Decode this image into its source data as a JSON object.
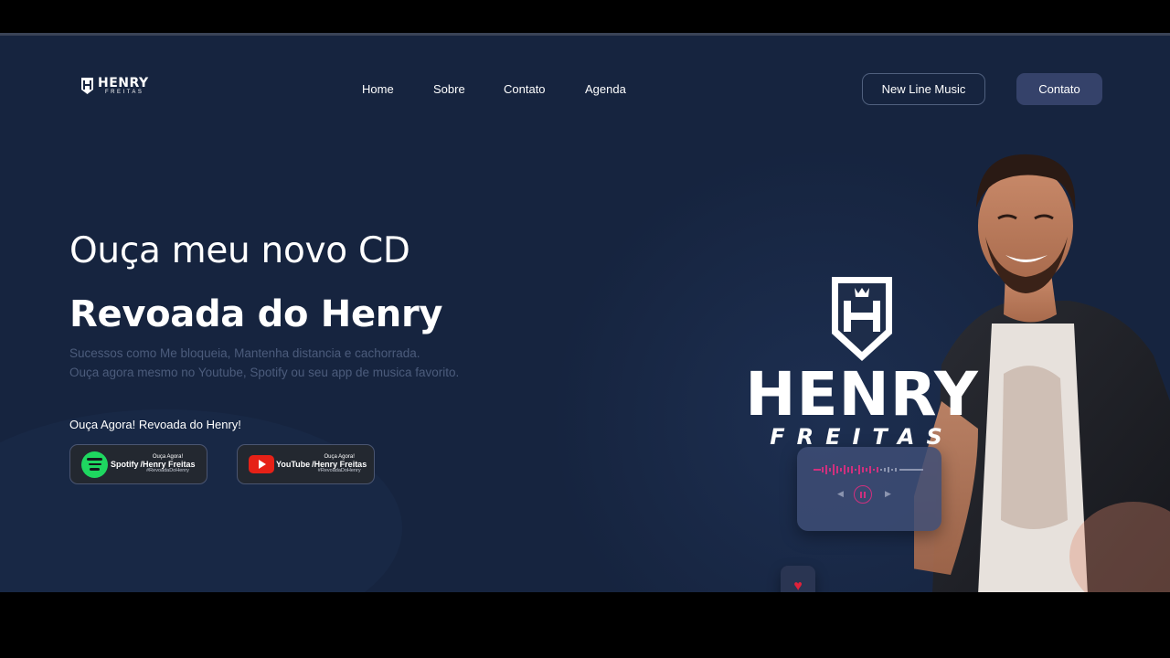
{
  "brand": {
    "name": "HENRY",
    "tagline": "FREITAS"
  },
  "nav": {
    "items": [
      {
        "label": "Home"
      },
      {
        "label": "Sobre"
      },
      {
        "label": "Contato"
      },
      {
        "label": "Agenda"
      }
    ]
  },
  "header_buttons": {
    "outline_label": "New Line Music",
    "solid_label": "Contato"
  },
  "hero": {
    "title": "Ouça meu novo CD",
    "album": "Revoada do Henry",
    "desc_line1": "Sucessos como Me bloqueia, Mantenha distancia e cachorrada.",
    "desc_line2": "Ouça agora mesmo no Youtube, Spotify ou seu app de musica favorito.",
    "listen_label": "Ouça Agora! Revoada do Henry!"
  },
  "streaming": {
    "spotify": {
      "brand": "Spotify",
      "top": "Ouça Agora!",
      "main": "/Henry Freitas",
      "tag": "#RevoadaDoHenry",
      "icon": "spotify-icon",
      "color": "#1ed760"
    },
    "youtube": {
      "brand": "YouTube",
      "top": "Ouça Agora!",
      "main": "/Henry Freitas",
      "tag": "#RevoadaDoHenry",
      "icon": "youtube-icon",
      "color": "#e62117"
    }
  },
  "artwork": {
    "logo_main": "HENRY",
    "logo_sub": "FREITAS",
    "player_icons": [
      "prev-icon",
      "pause-icon",
      "next-icon"
    ],
    "like_icon": "heart-icon"
  },
  "colors": {
    "background": "#16243f",
    "accent_button": "#35426a",
    "muted_text": "#4c5c7c"
  }
}
